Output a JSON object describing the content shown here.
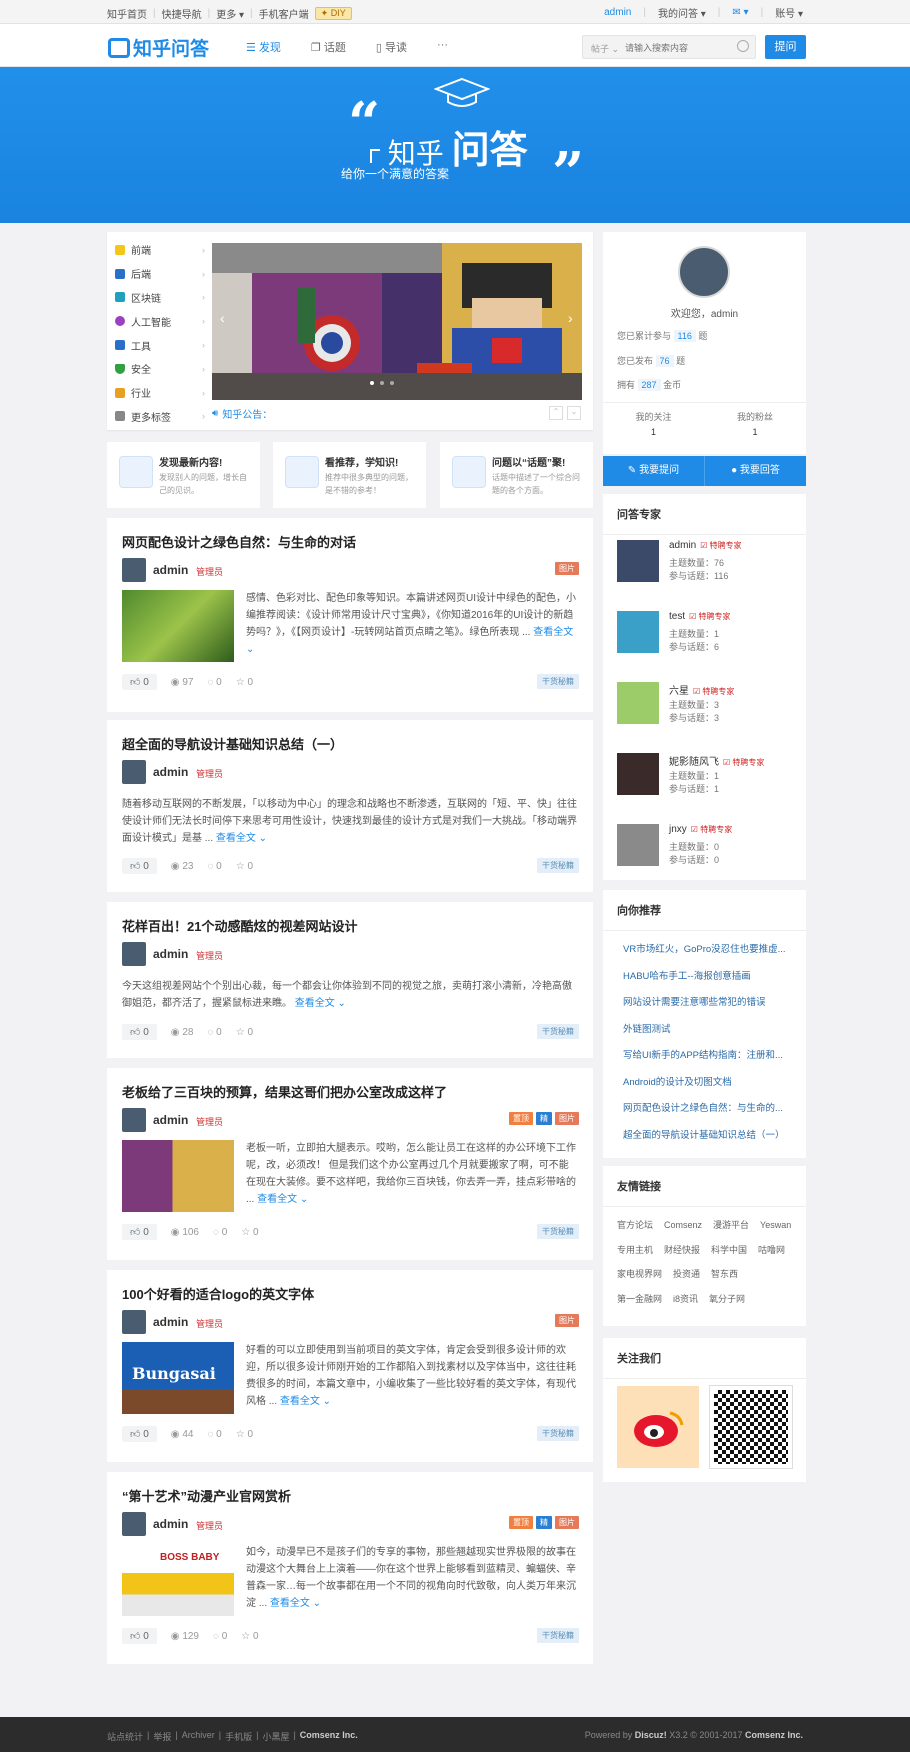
{
  "topbar": {
    "left": [
      "知乎首页",
      "快捷导航",
      "更多"
    ],
    "mobile": "手机客户端",
    "diy": "DIY",
    "user": "admin",
    "my_qa": "我的问答",
    "account": "账号"
  },
  "header": {
    "logo": "知乎问答",
    "nav": [
      "发现",
      "话题",
      "导读"
    ],
    "more": "···",
    "search_type": "帖子",
    "search_placeholder": "请输入搜索内容",
    "ask": "提问"
  },
  "banner": {
    "title_pre": "知乎",
    "title_main": "问答",
    "subtitle": "给你一个满意的答案"
  },
  "categories": [
    {
      "label": "前端",
      "color": "#f5c518"
    },
    {
      "label": "后端",
      "color": "#2a70c8"
    },
    {
      "label": "区块链",
      "color": "#20a0c0"
    },
    {
      "label": "人工智能",
      "color": "#9a40c0"
    },
    {
      "label": "工具",
      "color": "#2a70c8"
    },
    {
      "label": "安全",
      "color": "#30a040"
    },
    {
      "label": "行业",
      "color": "#e8a020"
    },
    {
      "label": "更多标签",
      "color": "#888888"
    }
  ],
  "notice": "知乎公告：",
  "promos": [
    {
      "title": "发现最新内容!",
      "desc": "发现别人的问题，增长自己的见识。"
    },
    {
      "title": "看推荐，学知识!",
      "desc": "推荐中很多典型的问题，是不错的参考！"
    },
    {
      "title": "问题以“话题”聚!",
      "desc": "话题中描述了一个综合问题的各个方面。"
    }
  ],
  "posts": [
    {
      "title": "网页配色设计之绿色自然：与生命的对话",
      "author": "admin",
      "role": "管理员",
      "tags": [
        {
          "t": "图片",
          "c": "t-img"
        }
      ],
      "excerpt": "感情、色彩对比、配色印象等知识。本篇讲述网页UI设计中绿色的配色，小编推荐阅读：《设计师常用设计尺寸宝典》，《你知道2016年的UI设计的新趋势吗？》，《【网页设计】-玩转网站首页点睛之笔》。绿色所表现 ...",
      "more": "查看全文",
      "likes": "0",
      "views": "97",
      "comments": "0",
      "favs": "0",
      "category": "干货秘籍"
    },
    {
      "title": "超全面的导航设计基础知识总结（一）",
      "author": "admin",
      "role": "管理员",
      "tags": [],
      "excerpt": "随着移动互联网的不断发展，「以移动为中心」的理念和战略也不断渗透，互联网的「短、平、快」往往使设计师们无法长时间停下来思考可用性设计，快速找到最佳的设计方式是对我们一大挑战。「移动端界面设计模式」是基 ...",
      "more": "查看全文",
      "likes": "0",
      "views": "23",
      "comments": "0",
      "favs": "0",
      "category": "干货秘籍"
    },
    {
      "title": "花样百出！21个动感酷炫的视差网站设计",
      "author": "admin",
      "role": "管理员",
      "tags": [],
      "excerpt": "今天这组视差网站个个别出心裁，每一个都会让你体验到不同的视觉之旅，卖萌打滚小清新，冷艳高傲御姐范，都齐活了，握紧鼠标进来瞧。",
      "more": "查看全文",
      "likes": "0",
      "views": "28",
      "comments": "0",
      "favs": "0",
      "category": "干货秘籍"
    },
    {
      "title": "老板给了三百块的预算，结果这哥们把办公室改成这样了",
      "author": "admin",
      "role": "管理员",
      "tags": [
        {
          "t": "置顶",
          "c": "t-top"
        },
        {
          "t": "精",
          "c": "t-ess"
        },
        {
          "t": "图片",
          "c": "t-img"
        }
      ],
      "excerpt": "老板一听，立即拍大腿表示。哎哟，怎么能让员工在这样的办公环境下工作呢，改，必须改！ 但是我们这个办公室再过几个月就要搬家了啊，可不能在现在大装修。要不这样吧，我给你三百块钱，你去弄一弄，挂点彩带啥的 ...",
      "more": "查看全文",
      "likes": "0",
      "views": "106",
      "comments": "0",
      "favs": "0",
      "category": "干货秘籍"
    },
    {
      "title": "100个好看的适合logo的英文字体",
      "author": "admin",
      "role": "管理员",
      "tags": [
        {
          "t": "图片",
          "c": "t-img"
        }
      ],
      "excerpt": "好看的可以立即使用到当前项目的英文字体，肯定会受到很多设计师的欢迎，所以很多设计师刚开始的工作都陷入到找素材以及字体当中，这往往耗费很多的时间，本篇文章中，小编收集了一些比较好看的英文字体，有现代风格 ...",
      "more": "查看全文",
      "likes": "0",
      "views": "44",
      "comments": "0",
      "favs": "0",
      "category": "干货秘籍",
      "thumb_text": "Bungasai"
    },
    {
      "title": "“第十艺术”动漫产业官网赏析",
      "author": "admin",
      "role": "管理员",
      "tags": [
        {
          "t": "置顶",
          "c": "t-top"
        },
        {
          "t": "精",
          "c": "t-ess"
        },
        {
          "t": "图片",
          "c": "t-img"
        }
      ],
      "excerpt": "如今，动漫早已不是孩子们的专享的事物，那些翘越现实世界极限的故事在动漫这个大舞台上上演着——你在这个世界上能够看到蓝精灵、蝙蝠侠、辛普森一家…每一个故事都在用一个不同的视角向时代致敬，向人类万年来沉淀 ...",
      "more": "查看全文",
      "likes": "0",
      "views": "129",
      "comments": "0",
      "favs": "0",
      "category": "干货秘籍",
      "thumb_text": "BOSS BABY"
    }
  ],
  "user": {
    "welcome": "欢迎您，admin",
    "joined_pre": "您已累计参与",
    "joined": "116",
    "joined_suf": "题",
    "posted_pre": "您已发布",
    "posted": "76",
    "posted_suf": "题",
    "coins_pre": "拥有",
    "coins": "287",
    "coins_suf": "金币",
    "follow_label": "我的关注",
    "follow": "1",
    "fans_label": "我的粉丝",
    "fans": "1",
    "ask": "我要提问",
    "answer": "我要回答"
  },
  "experts": {
    "title": "问答专家",
    "badge": "特聘专家",
    "topics_label": "主题数量：",
    "part_label": "参与话题：",
    "items": [
      {
        "name": "admin",
        "topics": "76",
        "part": "116"
      },
      {
        "name": "test",
        "topics": "1",
        "part": "6"
      },
      {
        "name": "六星",
        "topics": "3",
        "part": "3"
      },
      {
        "name": "妮影随风飞",
        "topics": "1",
        "part": "1"
      },
      {
        "name": "jnxy",
        "topics": "0",
        "part": "0"
      }
    ]
  },
  "recommend": {
    "title": "向你推荐",
    "items": [
      "VR市场红火，GoPro没忍住也要推虚...",
      "HABU哈布手工--海报创意插画",
      "网站设计需要注意哪些常犯的错误",
      "外链图测试",
      "写给UI新手的APP结构指南：注册和...",
      "Android的设计及切图文档",
      "网页配色设计之绿色自然：与生命的...",
      "超全面的导航设计基础知识总结（一）"
    ]
  },
  "links": {
    "title": "友情链接",
    "items": [
      "官方论坛",
      "Comsenz",
      "漫游平台",
      "Yeswan",
      "专用主机",
      "财经快报",
      "科学中国",
      "咕噜网",
      "家电视界网",
      "投资通",
      "智东西",
      "第一金融网",
      "i8资讯",
      "氧分子网"
    ]
  },
  "follow": {
    "title": "关注我们"
  },
  "footer": {
    "links": [
      "站点统计",
      "举报",
      "Archiver",
      "手机版",
      "小黑屋"
    ],
    "company": "Comsenz Inc.",
    "powered": "Powered by",
    "brand": "Discuz!",
    "version": "X3.2",
    "copy": "© 2001-2017",
    "company2": "Comsenz Inc."
  }
}
